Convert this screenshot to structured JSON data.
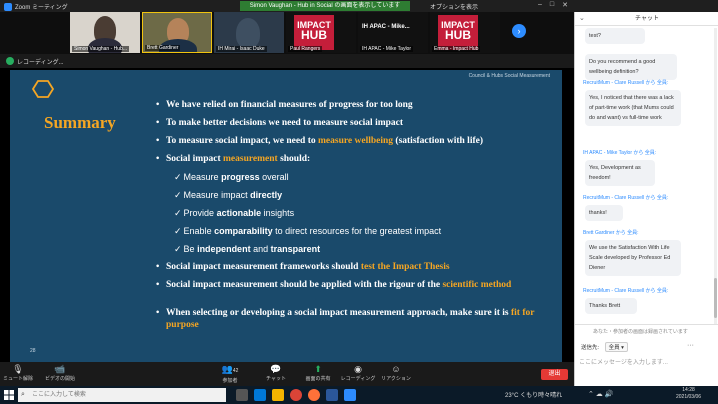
{
  "titlebar": {
    "app_title": "Zoom ミーティング",
    "center_label": "Simon Vaughan - Hub in Social の画面を表示しています",
    "options_label": "オプションを表示"
  },
  "gallery": {
    "tiles": [
      {
        "label": "Simon Vaughan - Hub..."
      },
      {
        "label": "Brett Gardiner"
      },
      {
        "label": "IH Mirai - Isaac Duke"
      },
      {
        "label": "Paul Rangers",
        "logo_line1": "IMPACT",
        "logo_line2": "HUB"
      },
      {
        "label": "IH APAC - Mike Taylor",
        "name": "IH APAC - Mike..."
      },
      {
        "label": "Emma - Impact Hub",
        "logo_line1": "IMPACT",
        "logo_line2": "HUB"
      }
    ]
  },
  "sharebar": {
    "text": "レコーディング..."
  },
  "slide": {
    "header_text": "Council & Hubs Social Measurement",
    "title": "Summary",
    "footer_num": "28",
    "b1": "We have relied on financial measures of progress for too long",
    "b2": "To make better decisions we need to measure social impact",
    "b3_pre": "To measure social impact, we need to ",
    "b3_hl": "measure wellbeing",
    "b3_post": " (satisfaction with life)",
    "b4_pre": "Social impact ",
    "b4_hl": "measurement",
    "b4_post": " should:",
    "s1_pre": "Measure ",
    "s1_b": "progress",
    "s1_post": " overall",
    "s2_pre": "Measure impact ",
    "s2_b": "directly",
    "s3_pre": "Provide ",
    "s3_b": "actionable",
    "s3_post": " insights",
    "s4_pre": "Enable ",
    "s4_b": "comparability",
    "s4_post": " to direct resources for the greatest impact",
    "s5_pre": "Be ",
    "s5_b": "independent",
    "s5_mid": " and ",
    "s5_b2": "transparent",
    "b5_pre": "Social impact measurement frameworks should ",
    "b5_hl": "test the Impact Thesis",
    "b6_pre": "Social impact measurement should be applied with the rigour of the ",
    "b6_hl": "scientific method",
    "b7_pre": "When selecting or developing a social impact measurement approach, make sure it is ",
    "b7_hl": "fit for purpose"
  },
  "toolbar": {
    "mute": "ミュート解除",
    "video": "ビデオの開始",
    "participants": "参加者",
    "participants_count": "42",
    "chat": "チャット",
    "share": "画面の共有",
    "record": "レコーディング",
    "reactions": "リアクション",
    "end": "退出"
  },
  "chat": {
    "title": "チャット",
    "m1_text": "test?",
    "m2_text": "Do you recommend a good wellbeing definition?",
    "m3_sender": "RecruitMum - Clare Russell から 全員:",
    "m3_text": "Yes, I noticed that there was a lack of part-time work (that Mums could do and want) vs full-time work",
    "m4_sender": "IH APAC - Mike Taylor から 全員:",
    "m4_text": "Yes, Development as freedom!",
    "m5_sender": "RecruitMum - Clare Russell から 全員:",
    "m5_text": "thanks!",
    "m6_sender": "Brett Gardiner から 全員:",
    "m6_text": "We use the Satisfaction With Life Scale developed by Professor Ed Diener",
    "m7_sender": "RecruitMum - Clare Russell から 全員:",
    "m7_text": "Thanks Brett",
    "notice": "あなた・参加者の画面は録画されています",
    "to_label": "送信先:",
    "to_value": "全員",
    "input_placeholder": "ここにメッセージを入力します..."
  },
  "taskbar": {
    "search_placeholder": "ここに入力して検索",
    "weather": "23°C くもり時々晴れ",
    "clock_time": "14:28",
    "clock_date": "2021/03/06"
  }
}
